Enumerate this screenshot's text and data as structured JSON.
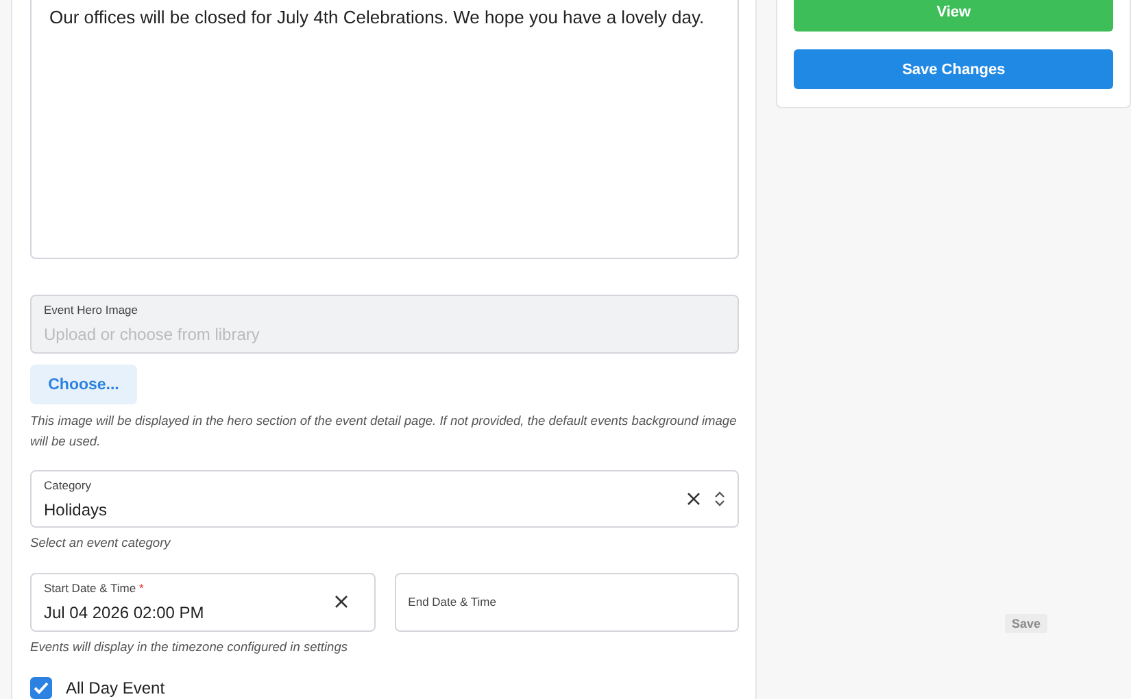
{
  "description": {
    "value": "Our offices will be closed for July 4th Celebrations. We hope you have a lovely day."
  },
  "hero_image": {
    "label": "Event Hero Image",
    "placeholder": "Upload or choose from library",
    "choose_button": "Choose...",
    "help": "This image will be displayed in the hero section of the event detail page. If not provided, the default events background image will be used."
  },
  "category": {
    "label": "Category",
    "value": "Holidays",
    "help": "Select an event category"
  },
  "start_date": {
    "label": "Start Date & Time",
    "required_mark": "*",
    "value": "Jul 04 2026 02:00 PM"
  },
  "end_date": {
    "label": "End Date & Time"
  },
  "date_help": "Events will display in the timezone configured in settings",
  "all_day": {
    "label": "All Day Event",
    "checked": true
  },
  "sidebar": {
    "buttons": [
      {
        "label": "View",
        "kind": "success"
      },
      {
        "label": "Save Changes",
        "kind": "primary"
      }
    ]
  },
  "floating_save": {
    "label": "Save",
    "disabled": true
  }
}
